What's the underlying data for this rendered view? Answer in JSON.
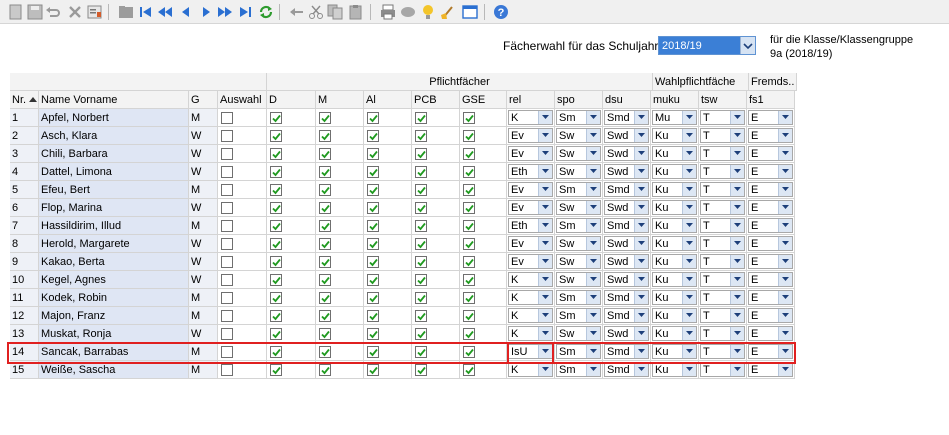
{
  "toolbar": {
    "buttons": [
      "new-doc-icon",
      "save-icon",
      "undo-icon",
      "delete-icon",
      "edit-icon",
      "folder-icon",
      "first-icon",
      "prev-page-icon",
      "prev-icon",
      "next-icon",
      "next-page-icon",
      "last-icon",
      "refresh-icon",
      "back-arrow-icon",
      "cut-icon",
      "copy-icon",
      "paste-icon",
      "print-icon",
      "preview-icon",
      "bulb-icon",
      "broom-icon",
      "window-icon",
      "help-icon"
    ]
  },
  "header": {
    "schuljahr_label": "Fächerwahl für das Schuljahr",
    "schuljahr_value": "2018/19",
    "klasse_line1": "für die Klasse/Klassengruppe",
    "klasse_line2": "9a (2018/19)"
  },
  "groups": {
    "pflicht": "Pflichtfächer",
    "wahlpflicht": "Wahlpflichtfäche",
    "fremd": "Fremds.."
  },
  "columns": {
    "nr": "Nr.",
    "name": "Name Vorname",
    "g": "G",
    "auswahl": "Auswahl",
    "d": "D",
    "m": "M",
    "al": "Al",
    "pcb": "PCB",
    "gse": "GSE",
    "rel": "rel",
    "spo": "spo",
    "dsu": "dsu",
    "muku": "muku",
    "tsw": "tsw",
    "fs1": "fs1"
  },
  "rows": [
    {
      "nr": "1",
      "name": "Apfel, Norbert",
      "g": "M",
      "rel": "K",
      "spo": "Sm",
      "dsu": "Smd",
      "muku": "Mu",
      "tsw": "T",
      "fs1": "E"
    },
    {
      "nr": "2",
      "name": "Asch, Klara",
      "g": "W",
      "rel": "Ev",
      "spo": "Sw",
      "dsu": "Swd",
      "muku": "Ku",
      "tsw": "T",
      "fs1": "E"
    },
    {
      "nr": "3",
      "name": "Chili, Barbara",
      "g": "W",
      "rel": "Ev",
      "spo": "Sw",
      "dsu": "Swd",
      "muku": "Ku",
      "tsw": "T",
      "fs1": "E"
    },
    {
      "nr": "4",
      "name": "Dattel, Limona",
      "g": "W",
      "rel": "Eth",
      "spo": "Sw",
      "dsu": "Swd",
      "muku": "Ku",
      "tsw": "T",
      "fs1": "E"
    },
    {
      "nr": "5",
      "name": "Efeu, Bert",
      "g": "M",
      "rel": "Ev",
      "spo": "Sm",
      "dsu": "Smd",
      "muku": "Ku",
      "tsw": "T",
      "fs1": "E"
    },
    {
      "nr": "6",
      "name": "Flop, Marina",
      "g": "W",
      "rel": "Ev",
      "spo": "Sw",
      "dsu": "Swd",
      "muku": "Ku",
      "tsw": "T",
      "fs1": "E"
    },
    {
      "nr": "7",
      "name": "Hassildirim, Illud",
      "g": "M",
      "rel": "Eth",
      "spo": "Sm",
      "dsu": "Smd",
      "muku": "Ku",
      "tsw": "T",
      "fs1": "E"
    },
    {
      "nr": "8",
      "name": "Herold, Margarete",
      "g": "W",
      "rel": "Ev",
      "spo": "Sw",
      "dsu": "Swd",
      "muku": "Ku",
      "tsw": "T",
      "fs1": "E"
    },
    {
      "nr": "9",
      "name": "Kakao, Berta",
      "g": "W",
      "rel": "Ev",
      "spo": "Sw",
      "dsu": "Swd",
      "muku": "Ku",
      "tsw": "T",
      "fs1": "E"
    },
    {
      "nr": "10",
      "name": "Kegel, Agnes",
      "g": "W",
      "rel": "K",
      "spo": "Sw",
      "dsu": "Swd",
      "muku": "Ku",
      "tsw": "T",
      "fs1": "E"
    },
    {
      "nr": "11",
      "name": "Kodek, Robin",
      "g": "M",
      "rel": "K",
      "spo": "Sm",
      "dsu": "Smd",
      "muku": "Ku",
      "tsw": "T",
      "fs1": "E"
    },
    {
      "nr": "12",
      "name": "Majon, Franz",
      "g": "M",
      "rel": "K",
      "spo": "Sm",
      "dsu": "Smd",
      "muku": "Ku",
      "tsw": "T",
      "fs1": "E"
    },
    {
      "nr": "13",
      "name": "Muskat, Ronja",
      "g": "W",
      "rel": "K",
      "spo": "Sw",
      "dsu": "Swd",
      "muku": "Ku",
      "tsw": "T",
      "fs1": "E"
    },
    {
      "nr": "14",
      "name": "Sancak, Barrabas",
      "g": "M",
      "rel": "IsU",
      "spo": "Sm",
      "dsu": "Smd",
      "muku": "Ku",
      "tsw": "T",
      "fs1": "E"
    },
    {
      "nr": "15",
      "name": "Weiße, Sascha",
      "g": "M",
      "rel": "K",
      "spo": "Sm",
      "dsu": "Smd",
      "muku": "Ku",
      "tsw": "T",
      "fs1": "E"
    }
  ],
  "colors": {
    "name_cell_bg": "#dfe6f4",
    "selected_bg": "#3b7fd6",
    "check": "#1f9a1f",
    "highlight": "#e02020"
  }
}
